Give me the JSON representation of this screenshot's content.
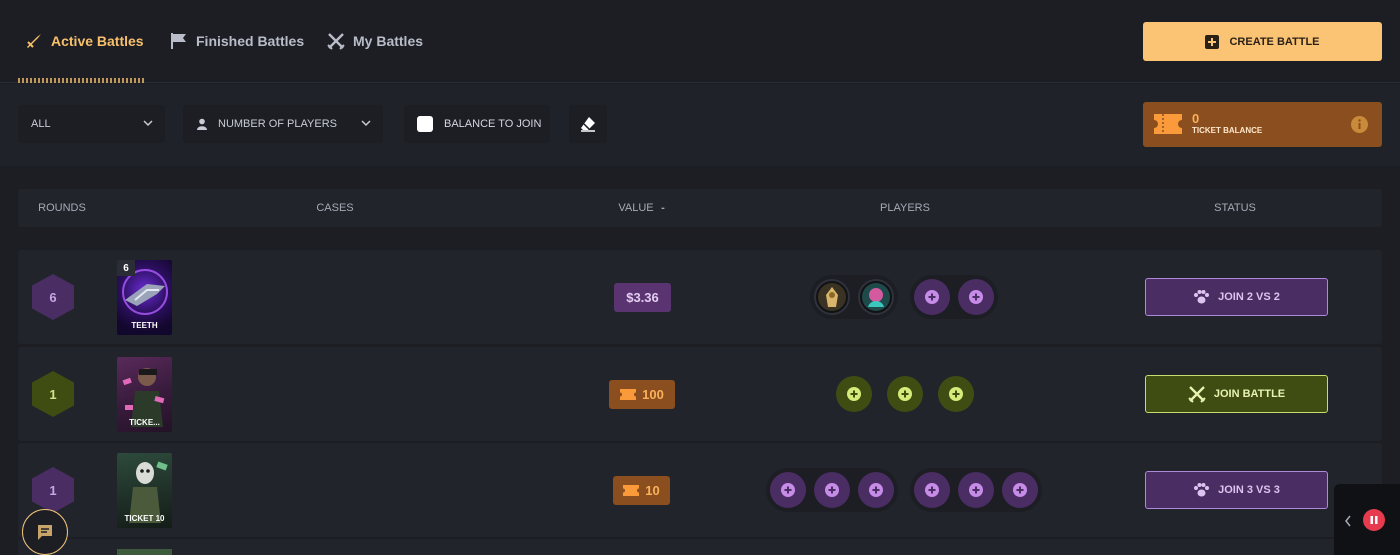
{
  "nav": {
    "tabs": [
      {
        "label": "Active Battles",
        "icon": "swords-icon"
      },
      {
        "label": "Finished Battles",
        "icon": "flag-icon"
      },
      {
        "label": "My Battles",
        "icon": "crossed-swords-icon"
      }
    ],
    "create_label": "CREATE BATTLE"
  },
  "filters": {
    "mode_select": "ALL",
    "players_select": "NUMBER OF PLAYERS",
    "balance_checkbox": "BALANCE TO JOIN",
    "balance_checked": false
  },
  "ticket_balance": {
    "value": "0",
    "label": "TICKET BALANCE"
  },
  "table": {
    "headers": {
      "rounds": "ROUNDS",
      "cases": "CASES",
      "value": "VALUE",
      "value_sort": "-",
      "players": "PLAYERS",
      "status": "STATUS"
    },
    "rows": [
      {
        "rounds": "6",
        "case_name": "TEETH",
        "case_count": "6",
        "value": "$3.36",
        "status": "JOIN 2 VS 2"
      },
      {
        "rounds": "1",
        "case_name": "TICKE...",
        "value": "100",
        "status": "JOIN BATTLE"
      },
      {
        "rounds": "1",
        "case_name": "TICKET 10",
        "value": "10",
        "status": "JOIN 3 VS 3"
      }
    ]
  },
  "colors": {
    "accent": "#fbc374",
    "purple": "#4a2d63",
    "green": "#3f4d12",
    "orange": "#8a4e1f",
    "background": "#1c1e24"
  }
}
